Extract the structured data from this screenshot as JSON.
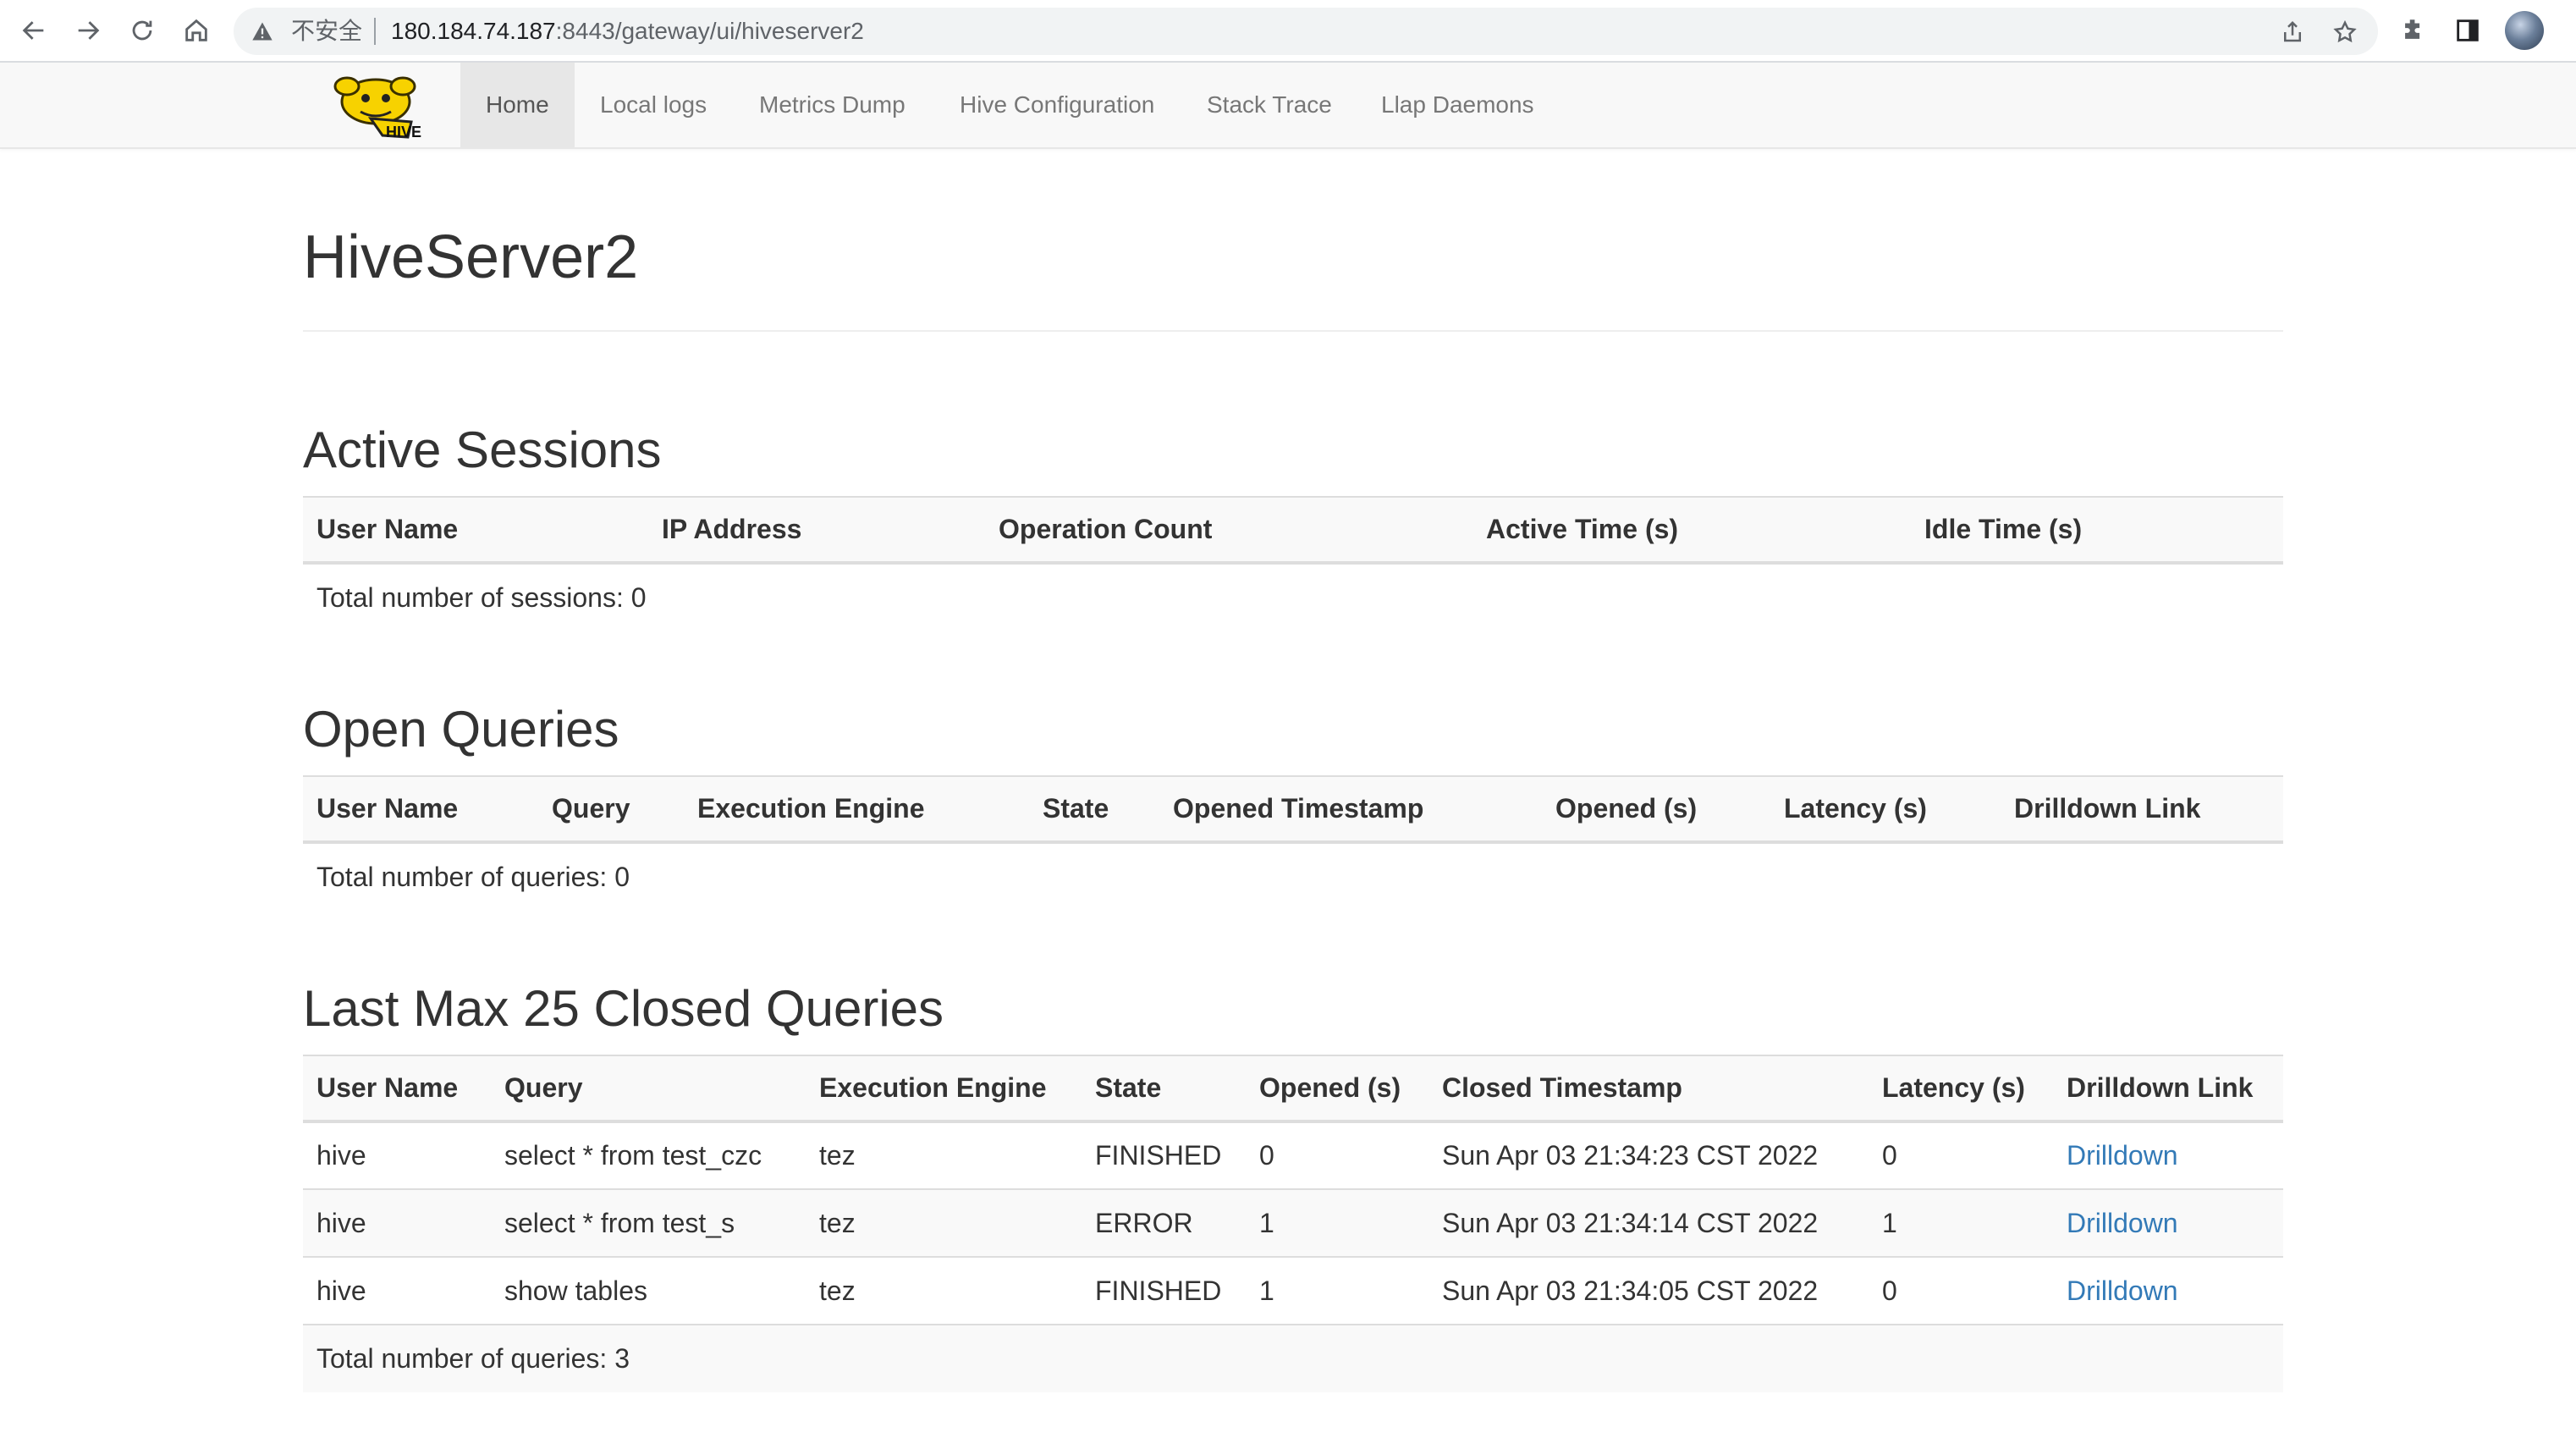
{
  "browser": {
    "insecure_label": "不安全",
    "url_host": "180.184.74.187",
    "url_rest": ":8443/gateway/ui/hiveserver2"
  },
  "navbar": {
    "logo": "hive-logo",
    "items": [
      {
        "label": "Home",
        "active": true
      },
      {
        "label": "Local logs"
      },
      {
        "label": "Metrics Dump"
      },
      {
        "label": "Hive Configuration"
      },
      {
        "label": "Stack Trace"
      },
      {
        "label": "Llap Daemons"
      }
    ]
  },
  "page_title": "HiveServer2",
  "active_sessions": {
    "title": "Active Sessions",
    "columns": [
      "User Name",
      "IP Address",
      "Operation Count",
      "Active Time (s)",
      "Idle Time (s)"
    ],
    "total": "Total number of sessions: 0"
  },
  "open_queries": {
    "title": "Open Queries",
    "columns": [
      "User Name",
      "Query",
      "Execution Engine",
      "State",
      "Opened Timestamp",
      "Opened (s)",
      "Latency (s)",
      "Drilldown Link"
    ],
    "total": "Total number of queries: 0"
  },
  "closed_queries": {
    "title": "Last Max 25 Closed Queries",
    "columns": [
      "User Name",
      "Query",
      "Execution Engine",
      "State",
      "Opened (s)",
      "Closed Timestamp",
      "Latency (s)",
      "Drilldown Link"
    ],
    "rows": [
      [
        "hive",
        "select * from test_czc",
        "tez",
        "FINISHED",
        "0",
        "Sun Apr 03 21:34:23 CST 2022",
        "0",
        "Drilldown"
      ],
      [
        "hive",
        "select * from test_s",
        "tez",
        "ERROR",
        "1",
        "Sun Apr 03 21:34:14 CST 2022",
        "1",
        "Drilldown"
      ],
      [
        "hive",
        "show tables",
        "tez",
        "FINISHED",
        "1",
        "Sun Apr 03 21:34:05 CST 2022",
        "0",
        "Drilldown"
      ]
    ],
    "total": "Total number of queries: 3"
  },
  "colors": {
    "link": "#337ab7",
    "navbar_bg": "#f8f8f8",
    "nav_active_bg": "#e7e7e7",
    "logo_yellow": "#f7d200"
  }
}
